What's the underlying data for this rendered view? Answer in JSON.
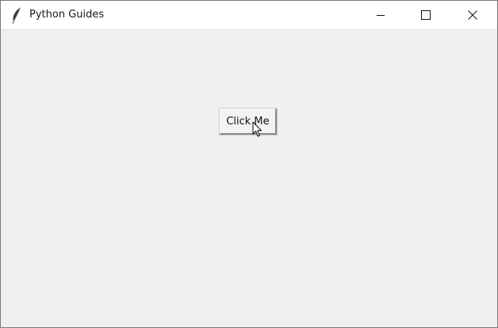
{
  "window": {
    "title": "Python Guides",
    "app_icon": "feather-icon",
    "controls": {
      "minimize": "minimize-icon",
      "maximize": "maximize-icon",
      "close": "close-icon"
    }
  },
  "main": {
    "button_label": "Click Me"
  },
  "colors": {
    "client_bg": "#f0f0f0",
    "titlebar_bg": "#ffffff"
  }
}
